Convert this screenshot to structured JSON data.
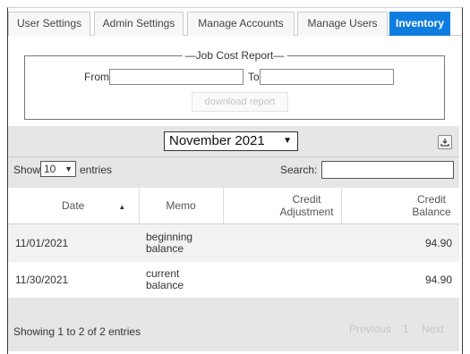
{
  "tabs": [
    {
      "label": "User Settings",
      "active": false
    },
    {
      "label": "Admin Settings",
      "active": false
    },
    {
      "label": "Manage Accounts",
      "active": false
    },
    {
      "label": "Manage Users",
      "active": false
    },
    {
      "label": "Inventory",
      "active": true
    }
  ],
  "report": {
    "title": "Job Cost Report",
    "from_label": "From",
    "to_label": "To",
    "from_value": "",
    "to_value": "",
    "download_label": "download report"
  },
  "month_select": {
    "value": "November 2021"
  },
  "table_controls": {
    "show_label": "Show",
    "length_value": "10",
    "entries_label": "entries",
    "search_label": "Search:",
    "search_value": ""
  },
  "table": {
    "columns": [
      "Date",
      "Memo",
      "Credit Adjustment",
      "Credit Balance"
    ],
    "rows": [
      {
        "date": "11/01/2021",
        "memo": "beginning balance",
        "adjustment": "",
        "balance": "94.90"
      },
      {
        "date": "11/30/2021",
        "memo": "current balance",
        "adjustment": "",
        "balance": "94.90"
      }
    ]
  },
  "footer": {
    "info": "Showing 1 to 2 of 2 entries",
    "previous": "Previous",
    "page": "1",
    "next": "Next"
  },
  "colors": {
    "accent": "#0f7de0",
    "panel": "#e6e6e6"
  }
}
